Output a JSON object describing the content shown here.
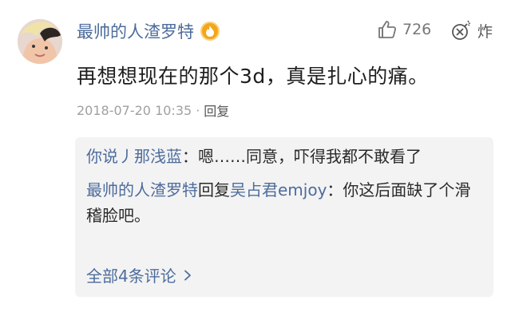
{
  "comment": {
    "username": "最帅的人渣罗特",
    "text": "再想想现在的那个3d，真是扎心的痛。",
    "timestamp": "2018-07-20 10:35",
    "reply_label": "回复",
    "like_count": "726",
    "explode_label": "炸"
  },
  "replies": [
    {
      "user": "你说丿那浅蓝",
      "separator": "：",
      "text": "嗯……同意，吓得我都不敢看了"
    },
    {
      "user": "最帅的人渣罗特",
      "reply_word": "回复",
      "target": "吴占君emjoy",
      "separator": "：",
      "text": "你这后面缺了个滑稽脸吧。"
    }
  ],
  "all_replies_label": "全部4条评论",
  "colors": {
    "username": "#4d6c9c",
    "reply_panel": "#f3f3f3",
    "badge": "#f4a51c"
  },
  "icons": [
    "avatar",
    "vip-badge-icon",
    "thumbs-up-icon",
    "bomb-icon",
    "chevron-right-icon"
  ]
}
